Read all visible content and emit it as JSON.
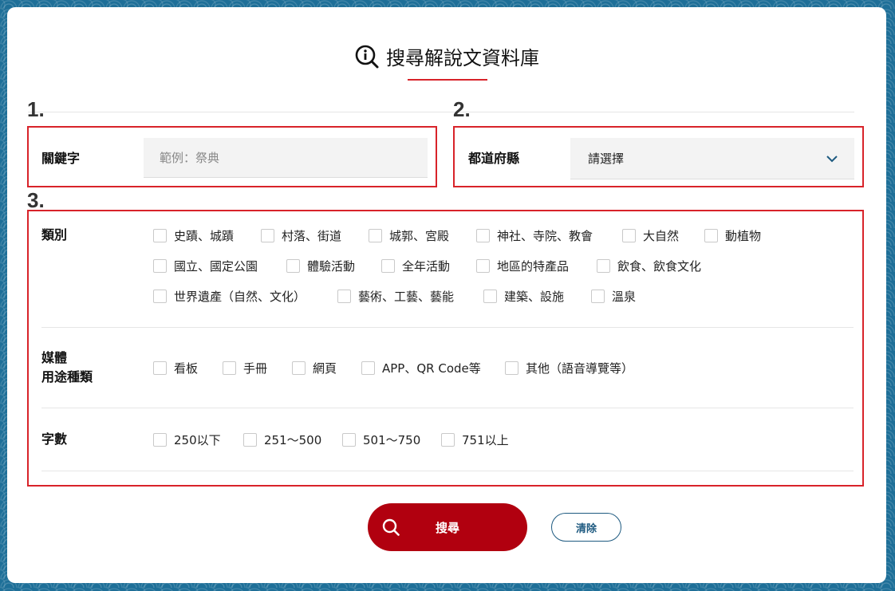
{
  "header": {
    "title": "搜尋解說文資料庫",
    "icon": "info-search-icon"
  },
  "steps": {
    "one": "1.",
    "two": "2.",
    "three": "3."
  },
  "keyword": {
    "label": "關鍵字",
    "placeholder": "範例：祭典",
    "value": ""
  },
  "prefecture": {
    "label": "都道府縣",
    "selected": "請選擇"
  },
  "category": {
    "label": "類別",
    "options": [
      "史蹟、城蹟",
      "村落、街道",
      "城郭、宮殿",
      "神社、寺院、教會",
      "大自然",
      "動植物",
      "國立、國定公園",
      "體驗活動",
      "全年活動",
      "地區的特產品",
      "飲食、飲食文化",
      "世界遺產（自然、文化）",
      "藝術、工藝、藝能",
      "建築、設施",
      "溫泉"
    ]
  },
  "media": {
    "label_line1": "媒體",
    "label_line2": "用途種類",
    "options": [
      "看板",
      "手冊",
      "網頁",
      "APP、QR Code等",
      "其他（語音導覽等）"
    ]
  },
  "wordcount": {
    "label": "字數",
    "options": [
      "250以下",
      "251～500",
      "501～750",
      "751以上"
    ]
  },
  "buttons": {
    "search": "搜尋",
    "clear": "清除"
  },
  "colors": {
    "accent": "#d8232a",
    "primary_button": "#b1000f",
    "secondary": "#1e5a80",
    "background": "#1e6f98"
  }
}
